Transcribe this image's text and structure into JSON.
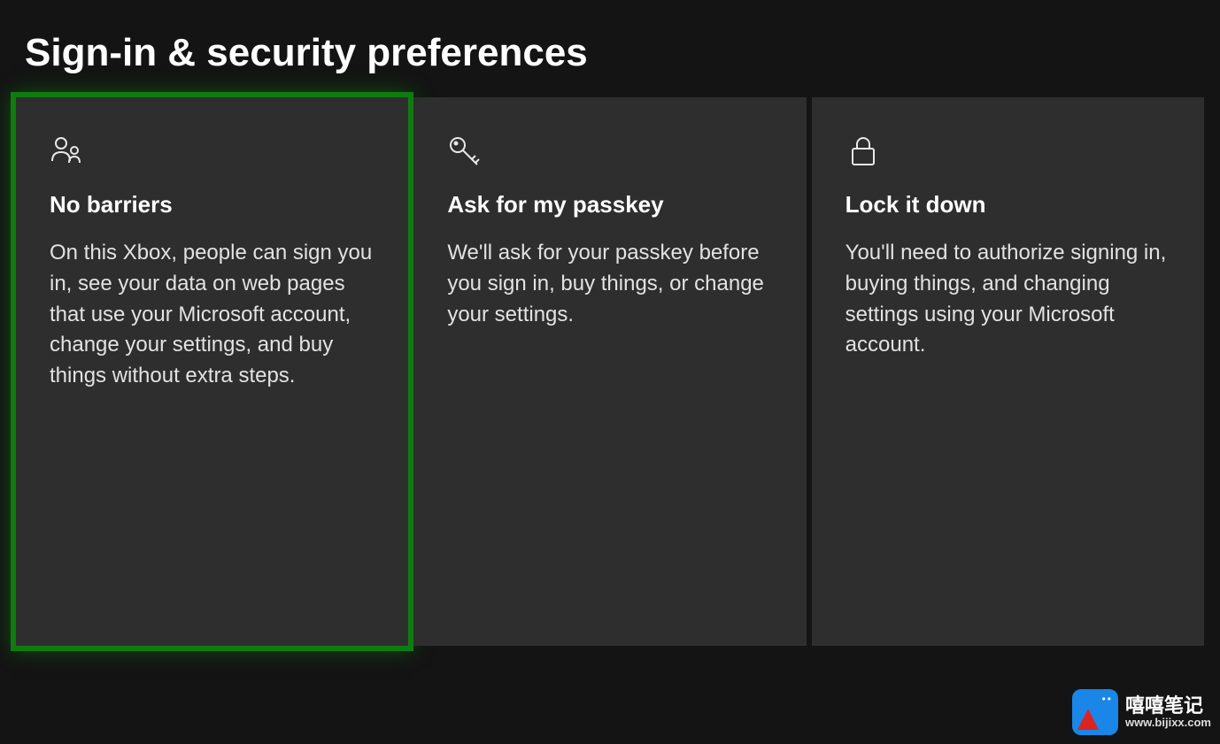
{
  "page_title": "Sign-in & security preferences",
  "options": [
    {
      "icon": "group-icon",
      "title": "No barriers",
      "description": "On this Xbox, people can sign you in, see your data on web pages that use your Microsoft account, change your settings, and buy things without extra steps.",
      "selected": true
    },
    {
      "icon": "key-icon",
      "title": "Ask for my passkey",
      "description": "We'll ask for your passkey before you sign in, buy things, or change your settings.",
      "selected": false
    },
    {
      "icon": "lock-icon",
      "title": "Lock it down",
      "description": "You'll need to authorize signing in, buying things, and changing settings using your Microsoft account.",
      "selected": false
    }
  ],
  "watermark": {
    "line1": "嘻嘻笔记",
    "line2": "www.bijixx.com"
  },
  "colors": {
    "accent": "#107c10",
    "card_bg": "#2e2e2e",
    "page_bg": "#141414"
  }
}
